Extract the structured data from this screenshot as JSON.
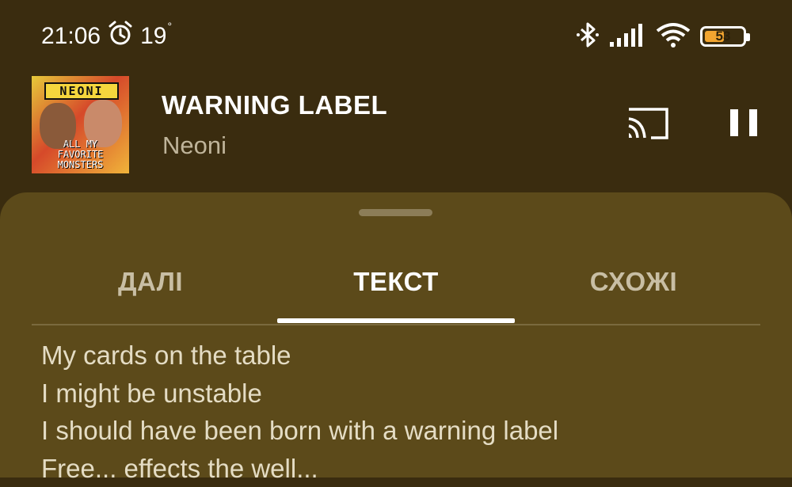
{
  "status_bar": {
    "time": "21:06",
    "temperature": "19",
    "temperature_unit": "°",
    "battery_level": "53",
    "battery_fraction": 0.53,
    "icons": [
      "alarm-icon",
      "bluetooth-icon",
      "signal-icon",
      "wifi-icon",
      "battery-icon"
    ]
  },
  "now_playing": {
    "album_art_band": "NEONI",
    "album_art_caption_1": "ALL MY",
    "album_art_caption_2": "FAVORITE",
    "album_art_caption_3": "MONSTERS",
    "title": "WARNING LABEL",
    "artist": "Neoni",
    "icons": [
      "cast-icon",
      "pause-icon"
    ]
  },
  "tabs": [
    {
      "label": "ДАЛІ",
      "active": false
    },
    {
      "label": "ТЕКСТ",
      "active": true
    },
    {
      "label": "СХОЖІ",
      "active": false
    }
  ],
  "lyrics": [
    "My cards on the table",
    "I might be unstable",
    "I should have been born with a warning label",
    "Free... effects the well..."
  ],
  "colors": {
    "background": "#3a2c0f",
    "sheet": "#5c4a1a",
    "battery_accent": "#f2a530"
  }
}
